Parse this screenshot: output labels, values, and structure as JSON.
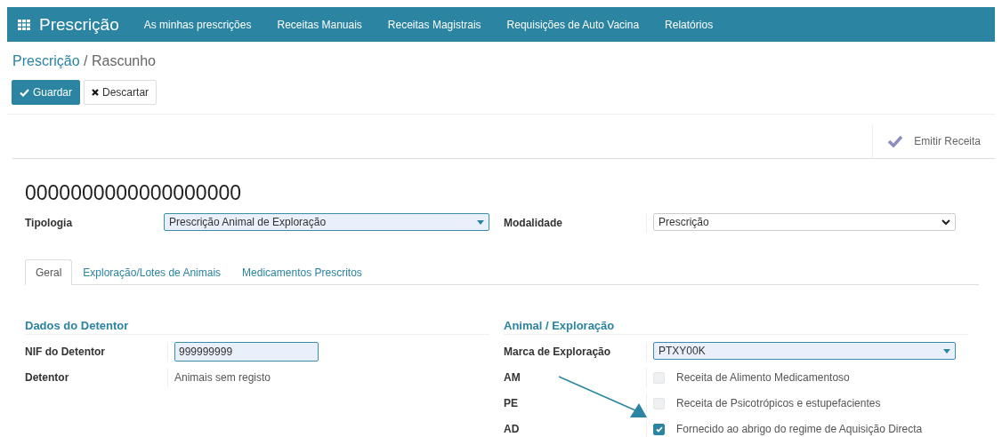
{
  "navbar": {
    "app_title": "Prescrição",
    "menu": [
      "As minhas prescrições",
      "Receitas Manuais",
      "Receitas Magistrais",
      "Requisições de Auto Vacina",
      "Relatórios"
    ]
  },
  "breadcrumb": {
    "parent": "Prescrição",
    "separator": "/",
    "current": "Rascunho"
  },
  "buttons": {
    "save": "Guardar",
    "discard": "Descartar"
  },
  "status_bar": {
    "action": "Emitir Receita"
  },
  "record": {
    "title": "0000000000000000000",
    "header_fields": [
      {
        "label": "Tipologia",
        "value": "Prescrição Animal de Exploração",
        "kind": "many2one"
      },
      {
        "label": "Modalidade",
        "value": "Prescrição",
        "kind": "select"
      }
    ],
    "tabs": [
      {
        "label": "Geral",
        "selected": true
      },
      {
        "label": "Exploração/Lotes de Animais",
        "selected": false
      },
      {
        "label": "Medicamentos Prescritos",
        "selected": false
      }
    ],
    "groups": [
      {
        "title": "Dados do Detentor",
        "rows": [
          {
            "label": "NIF do Detentor",
            "kind": "input",
            "value": "999999999"
          },
          {
            "label": "Detentor",
            "kind": "text",
            "value": "Animais sem registo"
          }
        ]
      },
      {
        "title": "Animal / Exploração",
        "rows": [
          {
            "label": "Marca de Exploração",
            "kind": "many2one",
            "value": "PTXY00K"
          },
          {
            "label": "AM",
            "kind": "checkbox",
            "value": "Receita de Alimento Medicamentoso",
            "checked": false
          },
          {
            "label": "PE",
            "kind": "checkbox",
            "value": "Receita de Psicotrópicos e estupefacientes",
            "checked": false
          },
          {
            "label": "AD",
            "kind": "checkbox",
            "value": "Fornecido ao abrigo do regime de Aquisição Directa",
            "checked": true
          }
        ]
      }
    ]
  }
}
